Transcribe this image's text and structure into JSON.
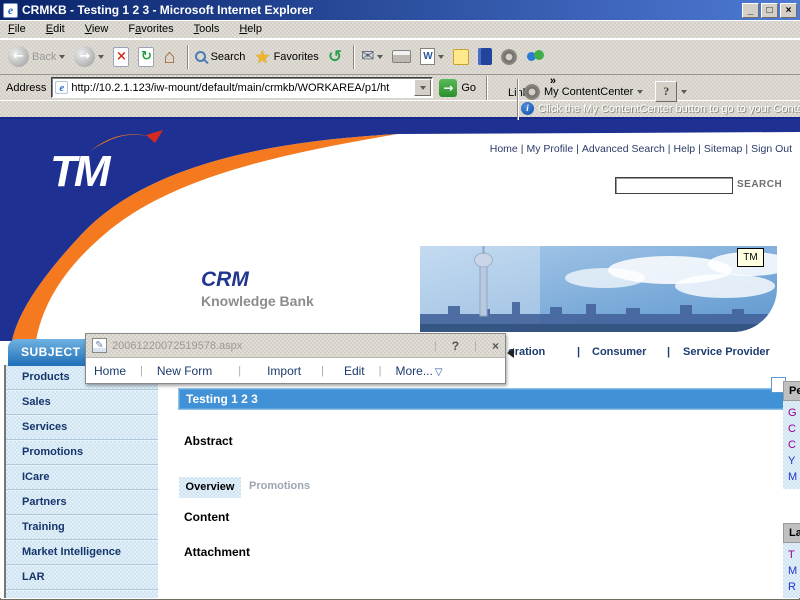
{
  "colors": {
    "title_gradient_left": "#0A246A",
    "title_gradient_right": "#4E7AD4",
    "chrome_gray": "#D4D0C8",
    "navy": "#1E3192",
    "orange": "#F4791F",
    "red_accent": "#D52B1E",
    "article_bar_blue": "#4191D6",
    "subject_tab_blue": "#1E6FB8",
    "panel_bg_blue": "#CFE3F1",
    "link_blue": "#2233CC",
    "link_visited": "#990099",
    "nav_navy": "#1D3C70"
  },
  "icons": {
    "ie_e": "e",
    "back_arrow": "←",
    "forward_arrow": "→",
    "stop_x": "×",
    "refresh": "↻",
    "home": "⌂",
    "star": "★",
    "history": "↺",
    "mail": "✉",
    "word_w": "W",
    "go_arrow": "→",
    "info_i": "i",
    "form_pencil": "✎"
  },
  "window": {
    "title": "CRMKB - Testing 1 2 3 - Microsoft Internet Explorer",
    "minimize": "_",
    "maximize": "□",
    "close": "×"
  },
  "menu": {
    "items": [
      "File",
      "Edit",
      "View",
      "Favorites",
      "Tools",
      "Help"
    ]
  },
  "toolbar": {
    "back": "Back",
    "search": "Search",
    "favorites": "Favorites"
  },
  "address": {
    "label": "Address",
    "url": "http://10.2.1.123/iw-mount/default/main/crmkb/WORKAREA/p1/ht",
    "go": "Go",
    "links": "Links",
    "overflow": "»"
  },
  "content_center": {
    "label": "My ContentCenter",
    "help": "?",
    "info_tip": "Click the My ContentCenter button to go to your Conten"
  },
  "site": {
    "logo": "TM",
    "nav": [
      "Home",
      "My Profile",
      "Advanced Search",
      "Help",
      "Sitemap",
      "Sign Out"
    ],
    "nav_sep": "|",
    "search_button": "SEARCH",
    "brand_title": "CRM",
    "brand_subtitle": "Knowledge Bank",
    "image_badge": "TM"
  },
  "popup": {
    "title": "20061220072519578.aspx",
    "help": "?",
    "close": "×",
    "menu": [
      "Home",
      "New Form",
      "Import",
      "Edit",
      "More..."
    ],
    "menu_sep": "|",
    "more_glyph": "▽"
  },
  "subject_tab": "SUBJECT",
  "category_nav": {
    "items": [
      "oration",
      "Consumer",
      "Service Provider"
    ],
    "sep": "|"
  },
  "sidebar": {
    "items": [
      "Products",
      "Sales",
      "Services",
      "Promotions",
      "ICare",
      "Partners",
      "Training",
      "Market Intelligence",
      "LAR"
    ]
  },
  "article": {
    "title": "Testing 1 2 3",
    "abstract_label": "Abstract",
    "tabs": [
      {
        "label": "Overview",
        "active": true
      },
      {
        "label": "Promotions",
        "active": false
      }
    ],
    "content_label": "Content",
    "attachment_label": "Attachment"
  },
  "panels": [
    {
      "header": "Pe",
      "links": [
        {
          "text": "G",
          "visited": true
        },
        {
          "text": "C",
          "visited": true
        },
        {
          "text": "C",
          "visited": true
        },
        {
          "text": "Y",
          "visited": false
        },
        {
          "text": "M",
          "visited": false
        }
      ]
    },
    {
      "header": "La",
      "links": [
        {
          "text": "T",
          "visited": true
        },
        {
          "text": "M",
          "visited": false
        },
        {
          "text": "R",
          "visited": false
        }
      ]
    }
  ]
}
